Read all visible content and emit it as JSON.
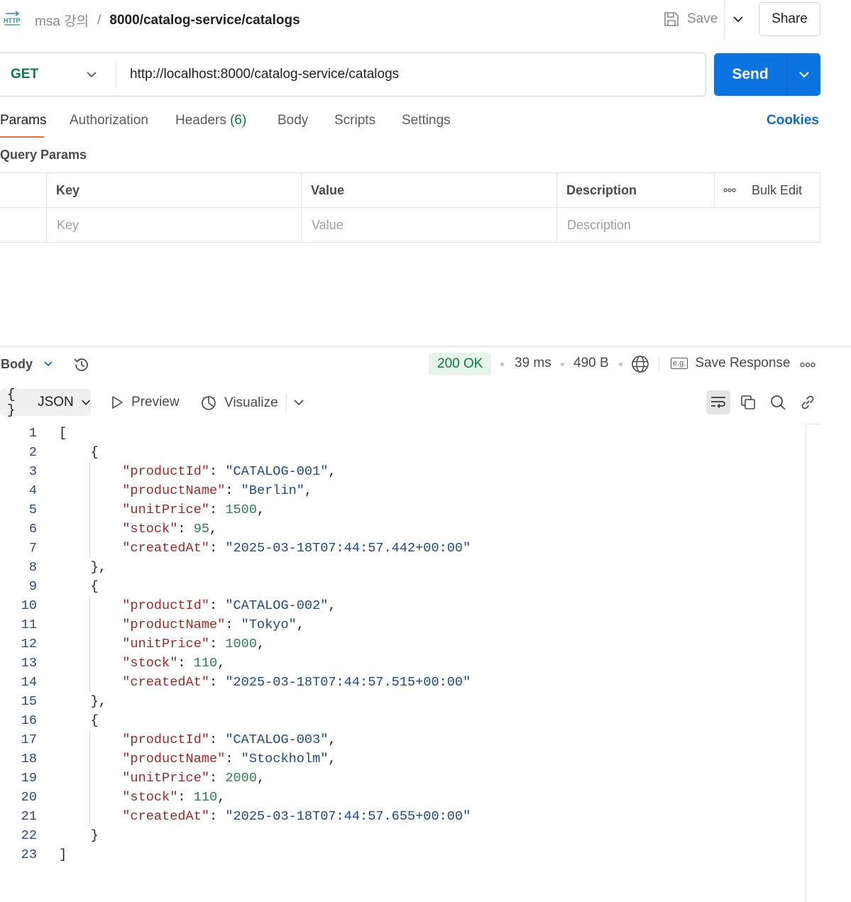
{
  "header": {
    "icon": "http-icon",
    "collection": "msa 강의",
    "separator": "/",
    "request_name": "8000/catalog-service/catalogs",
    "save_label": "Save",
    "share_label": "Share"
  },
  "request": {
    "method": "GET",
    "url": "http://localhost:8000/catalog-service/catalogs",
    "send_label": "Send"
  },
  "tabs": {
    "params": "Params",
    "authorization": "Authorization",
    "headers": "Headers",
    "headers_count": "(6)",
    "body": "Body",
    "scripts": "Scripts",
    "settings": "Settings",
    "cookies": "Cookies"
  },
  "query_params": {
    "title": "Query Params",
    "columns": [
      "Key",
      "Value",
      "Description"
    ],
    "bulk_edit": "Bulk Edit",
    "placeholders": [
      "Key",
      "Value",
      "Description"
    ]
  },
  "response": {
    "section_label": "Body",
    "status": "200 OK",
    "time": "39 ms",
    "size": "490 B",
    "save_response": "Save Response",
    "save_response_icon_text": "e.g.",
    "format": "JSON",
    "format_braces": "{ }",
    "preview": "Preview",
    "visualize": "Visualize"
  },
  "code_lines": [
    {
      "n": "1",
      "t": [
        [
          "p",
          "["
        ]
      ]
    },
    {
      "n": "2",
      "t": [
        [
          "p",
          "    {"
        ]
      ]
    },
    {
      "n": "3",
      "t": [
        [
          "p",
          "        "
        ],
        [
          "k",
          "\"productId\""
        ],
        [
          "p",
          ": "
        ],
        [
          "s",
          "\"CATALOG-001\""
        ],
        [
          "p",
          ","
        ]
      ]
    },
    {
      "n": "4",
      "t": [
        [
          "p",
          "        "
        ],
        [
          "k",
          "\"productName\""
        ],
        [
          "p",
          ": "
        ],
        [
          "s",
          "\"Berlin\""
        ],
        [
          "p",
          ","
        ]
      ]
    },
    {
      "n": "5",
      "t": [
        [
          "p",
          "        "
        ],
        [
          "k",
          "\"unitPrice\""
        ],
        [
          "p",
          ": "
        ],
        [
          "n",
          "1500"
        ],
        [
          "p",
          ","
        ]
      ]
    },
    {
      "n": "6",
      "t": [
        [
          "p",
          "        "
        ],
        [
          "k",
          "\"stock\""
        ],
        [
          "p",
          ": "
        ],
        [
          "n",
          "95"
        ],
        [
          "p",
          ","
        ]
      ]
    },
    {
      "n": "7",
      "t": [
        [
          "p",
          "        "
        ],
        [
          "k",
          "\"createdAt\""
        ],
        [
          "p",
          ": "
        ],
        [
          "s",
          "\"2025-03-18T07:44:57.442+00:00\""
        ]
      ]
    },
    {
      "n": "8",
      "t": [
        [
          "p",
          "    },"
        ]
      ]
    },
    {
      "n": "9",
      "t": [
        [
          "p",
          "    {"
        ]
      ]
    },
    {
      "n": "10",
      "t": [
        [
          "p",
          "        "
        ],
        [
          "k",
          "\"productId\""
        ],
        [
          "p",
          ": "
        ],
        [
          "s",
          "\"CATALOG-002\""
        ],
        [
          "p",
          ","
        ]
      ]
    },
    {
      "n": "11",
      "t": [
        [
          "p",
          "        "
        ],
        [
          "k",
          "\"productName\""
        ],
        [
          "p",
          ": "
        ],
        [
          "s",
          "\"Tokyo\""
        ],
        [
          "p",
          ","
        ]
      ]
    },
    {
      "n": "12",
      "t": [
        [
          "p",
          "        "
        ],
        [
          "k",
          "\"unitPrice\""
        ],
        [
          "p",
          ": "
        ],
        [
          "n",
          "1000"
        ],
        [
          "p",
          ","
        ]
      ]
    },
    {
      "n": "13",
      "t": [
        [
          "p",
          "        "
        ],
        [
          "k",
          "\"stock\""
        ],
        [
          "p",
          ": "
        ],
        [
          "n",
          "110"
        ],
        [
          "p",
          ","
        ]
      ]
    },
    {
      "n": "14",
      "t": [
        [
          "p",
          "        "
        ],
        [
          "k",
          "\"createdAt\""
        ],
        [
          "p",
          ": "
        ],
        [
          "s",
          "\"2025-03-18T07:44:57.515+00:00\""
        ]
      ]
    },
    {
      "n": "15",
      "t": [
        [
          "p",
          "    },"
        ]
      ]
    },
    {
      "n": "16",
      "t": [
        [
          "p",
          "    {"
        ]
      ]
    },
    {
      "n": "17",
      "t": [
        [
          "p",
          "        "
        ],
        [
          "k",
          "\"productId\""
        ],
        [
          "p",
          ": "
        ],
        [
          "s",
          "\"CATALOG-003\""
        ],
        [
          "p",
          ","
        ]
      ]
    },
    {
      "n": "18",
      "t": [
        [
          "p",
          "        "
        ],
        [
          "k",
          "\"productName\""
        ],
        [
          "p",
          ": "
        ],
        [
          "s",
          "\"Stockholm\""
        ],
        [
          "p",
          ","
        ]
      ]
    },
    {
      "n": "19",
      "t": [
        [
          "p",
          "        "
        ],
        [
          "k",
          "\"unitPrice\""
        ],
        [
          "p",
          ": "
        ],
        [
          "n",
          "2000"
        ],
        [
          "p",
          ","
        ]
      ]
    },
    {
      "n": "20",
      "t": [
        [
          "p",
          "        "
        ],
        [
          "k",
          "\"stock\""
        ],
        [
          "p",
          ": "
        ],
        [
          "n",
          "110"
        ],
        [
          "p",
          ","
        ]
      ]
    },
    {
      "n": "21",
      "t": [
        [
          "p",
          "        "
        ],
        [
          "k",
          "\"createdAt\""
        ],
        [
          "p",
          ": "
        ],
        [
          "s",
          "\"2025-03-18T07:44:57.655+00:00\""
        ]
      ]
    },
    {
      "n": "22",
      "t": [
        [
          "p",
          "    }"
        ]
      ]
    },
    {
      "n": "23",
      "t": [
        [
          "p",
          "]"
        ]
      ]
    }
  ],
  "colors": {
    "accent": "#0b74e0",
    "method": "#0a7b41",
    "status_ok_bg": "#e7f6ec",
    "active_tab_underline": "#ee6f2f",
    "json_key": "#9a2a2a",
    "json_string": "#1a4a8c",
    "json_number": "#2e7d55"
  }
}
